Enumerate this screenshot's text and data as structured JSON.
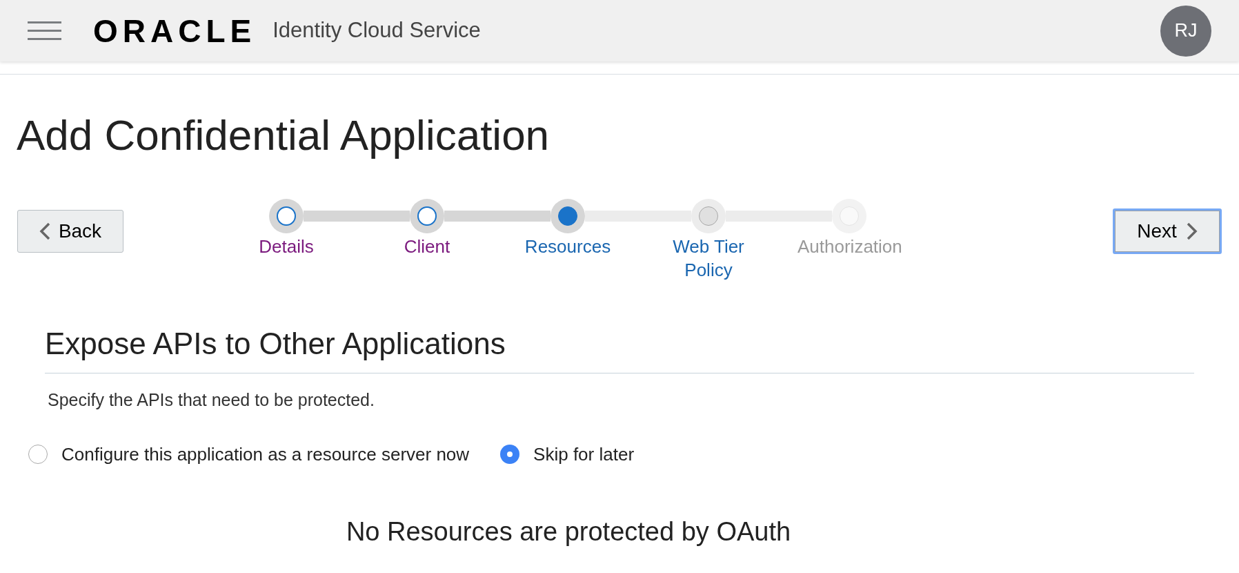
{
  "header": {
    "logo": "ORACLE",
    "product": "Identity Cloud Service",
    "avatar": "RJ"
  },
  "page": {
    "title": "Add Confidential Application"
  },
  "wizard": {
    "back": "Back",
    "next": "Next",
    "steps": [
      {
        "label": "Details",
        "selected": false,
        "visited": true,
        "disabled": false
      },
      {
        "label": "Client",
        "selected": false,
        "visited": true,
        "disabled": false
      },
      {
        "label": "Resources",
        "selected": true,
        "visited": false,
        "disabled": false
      },
      {
        "label": "Web Tier Policy",
        "selected": false,
        "visited": false,
        "disabled": false
      },
      {
        "label": "Authorization",
        "selected": false,
        "visited": false,
        "disabled": true
      }
    ]
  },
  "section": {
    "title": "Expose APIs to Other Applications",
    "description": "Specify the APIs that need to be protected.",
    "options": [
      {
        "label": "Configure this application as a resource server now",
        "selected": false
      },
      {
        "label": "Skip for later",
        "selected": true
      }
    ],
    "empty_message": "No Resources are protected by OAuth"
  }
}
